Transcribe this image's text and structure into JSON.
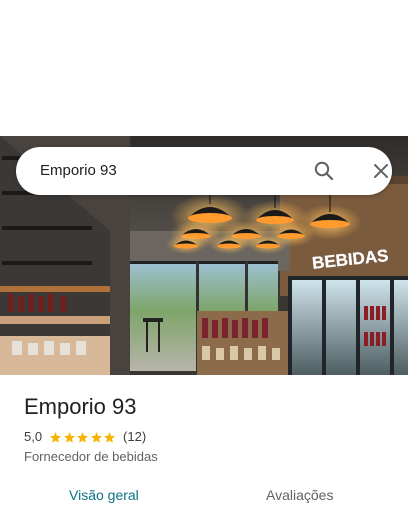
{
  "search": {
    "query": "Emporio 93"
  },
  "icons": {
    "search": "search-icon",
    "close": "close-icon",
    "star": "star-icon"
  },
  "hero": {
    "sign_text": "BEBIDAS"
  },
  "place": {
    "name": "Emporio 93",
    "rating": "5,0",
    "stars": 5,
    "reviews": "(12)",
    "category": "Fornecedor de bebidas"
  },
  "tabs": {
    "overview": "Visão geral",
    "reviews": "Avaliações"
  },
  "colors": {
    "star": "#f5b400",
    "active_tab": "#0b7285",
    "inactive_tab": "#5f6368"
  }
}
